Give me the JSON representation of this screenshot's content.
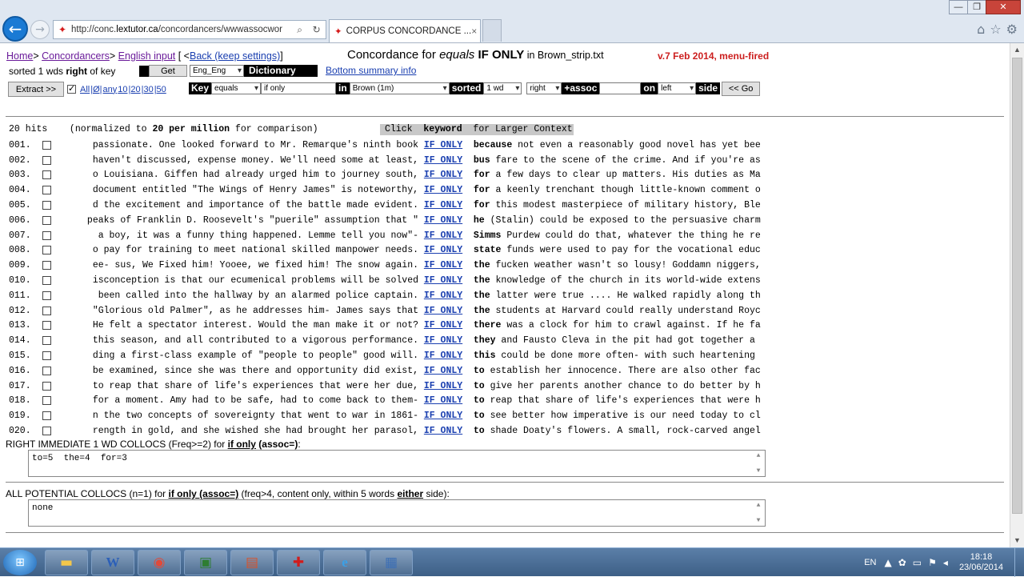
{
  "browser": {
    "url_prefix": "http://conc.",
    "url_domain": "lextutor.ca",
    "url_suffix": "/concordancers/wwwassocwor",
    "tab_title": "CORPUS CONCORDANCE ...",
    "tab_close": "×",
    "search_icon": "search-icon",
    "refresh_icon": "refresh-icon"
  },
  "header": {
    "home": "Home",
    "concordancers": "Concordancers",
    "english_input": "English input",
    "back_prefix": "[ <",
    "back": "Back (keep settings)",
    "back_suffix": "]",
    "title_prefix": "Concordance for ",
    "title_key": "equals",
    "title_assoc": "IF ONLY",
    "title_in": " in Brown_strip.txt",
    "version": "v.7 Feb 2014, menu-fired",
    "sorted_prefix": "sorted 1 wds ",
    "sorted_bold": "right",
    "sorted_suffix": " of key",
    "get_label": "Get",
    "dict_value": "Eng_Eng",
    "dict_label": "Dictionary",
    "summary_link": "Bottom summary info"
  },
  "controls": {
    "extract_label": "Extract >>",
    "amount_links": [
      "All",
      "|Ø|",
      "any",
      "10",
      "|20",
      "|30",
      "|50"
    ],
    "key_label": "Key",
    "key_select": "equals",
    "key_input": "if only",
    "in_label": "in",
    "corpus_select": "Brown (1m)",
    "sorted_label": "sorted",
    "sort_select": "1 wd",
    "side_select": "right",
    "assoc_label": "+assoc",
    "assoc_input": "",
    "on_label": "on",
    "on_select": "left",
    "side_label": "side",
    "go_label": "<< Go"
  },
  "results": {
    "hits": "20 hits",
    "normalized_prefix": "    (normalized to ",
    "normalized_bold": "20 per million",
    "normalized_suffix": " for comparison)",
    "context_hint_prefix": "Click  ",
    "context_hint_bold": "keyword",
    "context_hint_suffix": "  for Larger Context",
    "keyword": "IF ONLY",
    "lines": [
      {
        "num": "001.",
        "left": "passionate. One looked forward to Mr. Remarque's ninth book",
        "next": "because",
        "right": " not even a reasonably good novel has yet bee"
      },
      {
        "num": "002.",
        "left": "haven't discussed, expense money. We'll need some at least,",
        "next": "bus",
        "right": " fare to the scene of the crime. And if you're as"
      },
      {
        "num": "003.",
        "left": "o Louisiana. Giffen had already urged him to journey south,",
        "next": "for",
        "right": " a few days to clear up matters. His duties as Ma"
      },
      {
        "num": "004.",
        "left": "document entitled \"The Wings of Henry James\" is noteworthy,",
        "next": "for",
        "right": " a keenly trenchant though little-known comment o"
      },
      {
        "num": "005.",
        "left": "d the excitement and importance of the battle made evident.",
        "next": "for",
        "right": " this modest masterpiece of military history, Ble"
      },
      {
        "num": "006.",
        "left": "peaks of Franklin D. Roosevelt's \"puerile\" assumption that \"",
        "next": "he",
        "right": " (Stalin) could be exposed to the persuasive charm"
      },
      {
        "num": "007.",
        "left": " a boy, it was a funny thing happened. Lemme tell you now\"-",
        "next": "Simms",
        "right": " Purdew could do that, whatever the thing he re"
      },
      {
        "num": "008.",
        "left": "o pay for training to meet national skilled manpower needs.",
        "next": "state",
        "right": " funds were used to pay for the vocational educ"
      },
      {
        "num": "009.",
        "left": "ee- sus, We Fixed him! Yooee, we fixed him! The snow again.",
        "next": "the",
        "right": " fucken weather wasn't so lousy! Goddamn niggers,"
      },
      {
        "num": "010.",
        "left": "isconception is that our ecumenical problems will be solved",
        "next": "the",
        "right": " knowledge of the church in its world-wide extens"
      },
      {
        "num": "011.",
        "left": " been called into the hallway by an alarmed police captain.",
        "next": "the",
        "right": " latter were true .... He walked rapidly along th"
      },
      {
        "num": "012.",
        "left": "\"Glorious old Palmer\", as he addresses him- James says that",
        "next": "the",
        "right": " students at Harvard could really understand Royc"
      },
      {
        "num": "013.",
        "left": "He felt a spectator interest. Would the man make it or not?",
        "next": "there",
        "right": " was a clock for him to crawl against. If he fa"
      },
      {
        "num": "014.",
        "left": "this season, and all contributed to a vigorous performance.",
        "next": "they",
        "right": " and Fausto Cleva in the pit had got together a"
      },
      {
        "num": "015.",
        "left": "ding a first-class example of \"people to people\" good will.",
        "next": "this",
        "right": " could be done more often- with such heartening"
      },
      {
        "num": "016.",
        "left": "be examined, since she was there and opportunity did exist,",
        "next": "to",
        "right": " establish her innocence. There are also other fac"
      },
      {
        "num": "017.",
        "left": "to reap that share of life's experiences that were her due,",
        "next": "to",
        "right": " give her parents another chance to do better by h"
      },
      {
        "num": "018.",
        "left": "for a moment. Amy had to be safe, had to come back to them-",
        "next": "to",
        "right": " reap that share of life's experiences that were h"
      },
      {
        "num": "019.",
        "left": "n the two concepts of sovereignty that went to war in 1861-",
        "next": "to",
        "right": " see better how imperative is our need today to cl"
      },
      {
        "num": "020.",
        "left": "rength in gold, and she wished she had brought her parasol,",
        "next": "to",
        "right": " shade Doaty's flowers. A small, rock-carved angel"
      }
    ]
  },
  "collocs": {
    "label_prefix": "RIGHT IMMEDIATE 1 WD COLLOCS (Freq>=2) for ",
    "label_key": "if only",
    "label_assoc": " (assoc=)",
    "label_suffix": ":",
    "value": "to=5  the=4  for=3"
  },
  "potential": {
    "label_prefix": "ALL POTENTIAL COLLOCS (n=1) for ",
    "label_key": "if only (assoc=)",
    "label_mid": " (freq>4, content only, within 5 words ",
    "label_either": "either",
    "label_suffix": " side):",
    "value": "none"
  },
  "taskbar": {
    "lang": "EN",
    "time": "18:18",
    "date": "23/06/2014"
  }
}
